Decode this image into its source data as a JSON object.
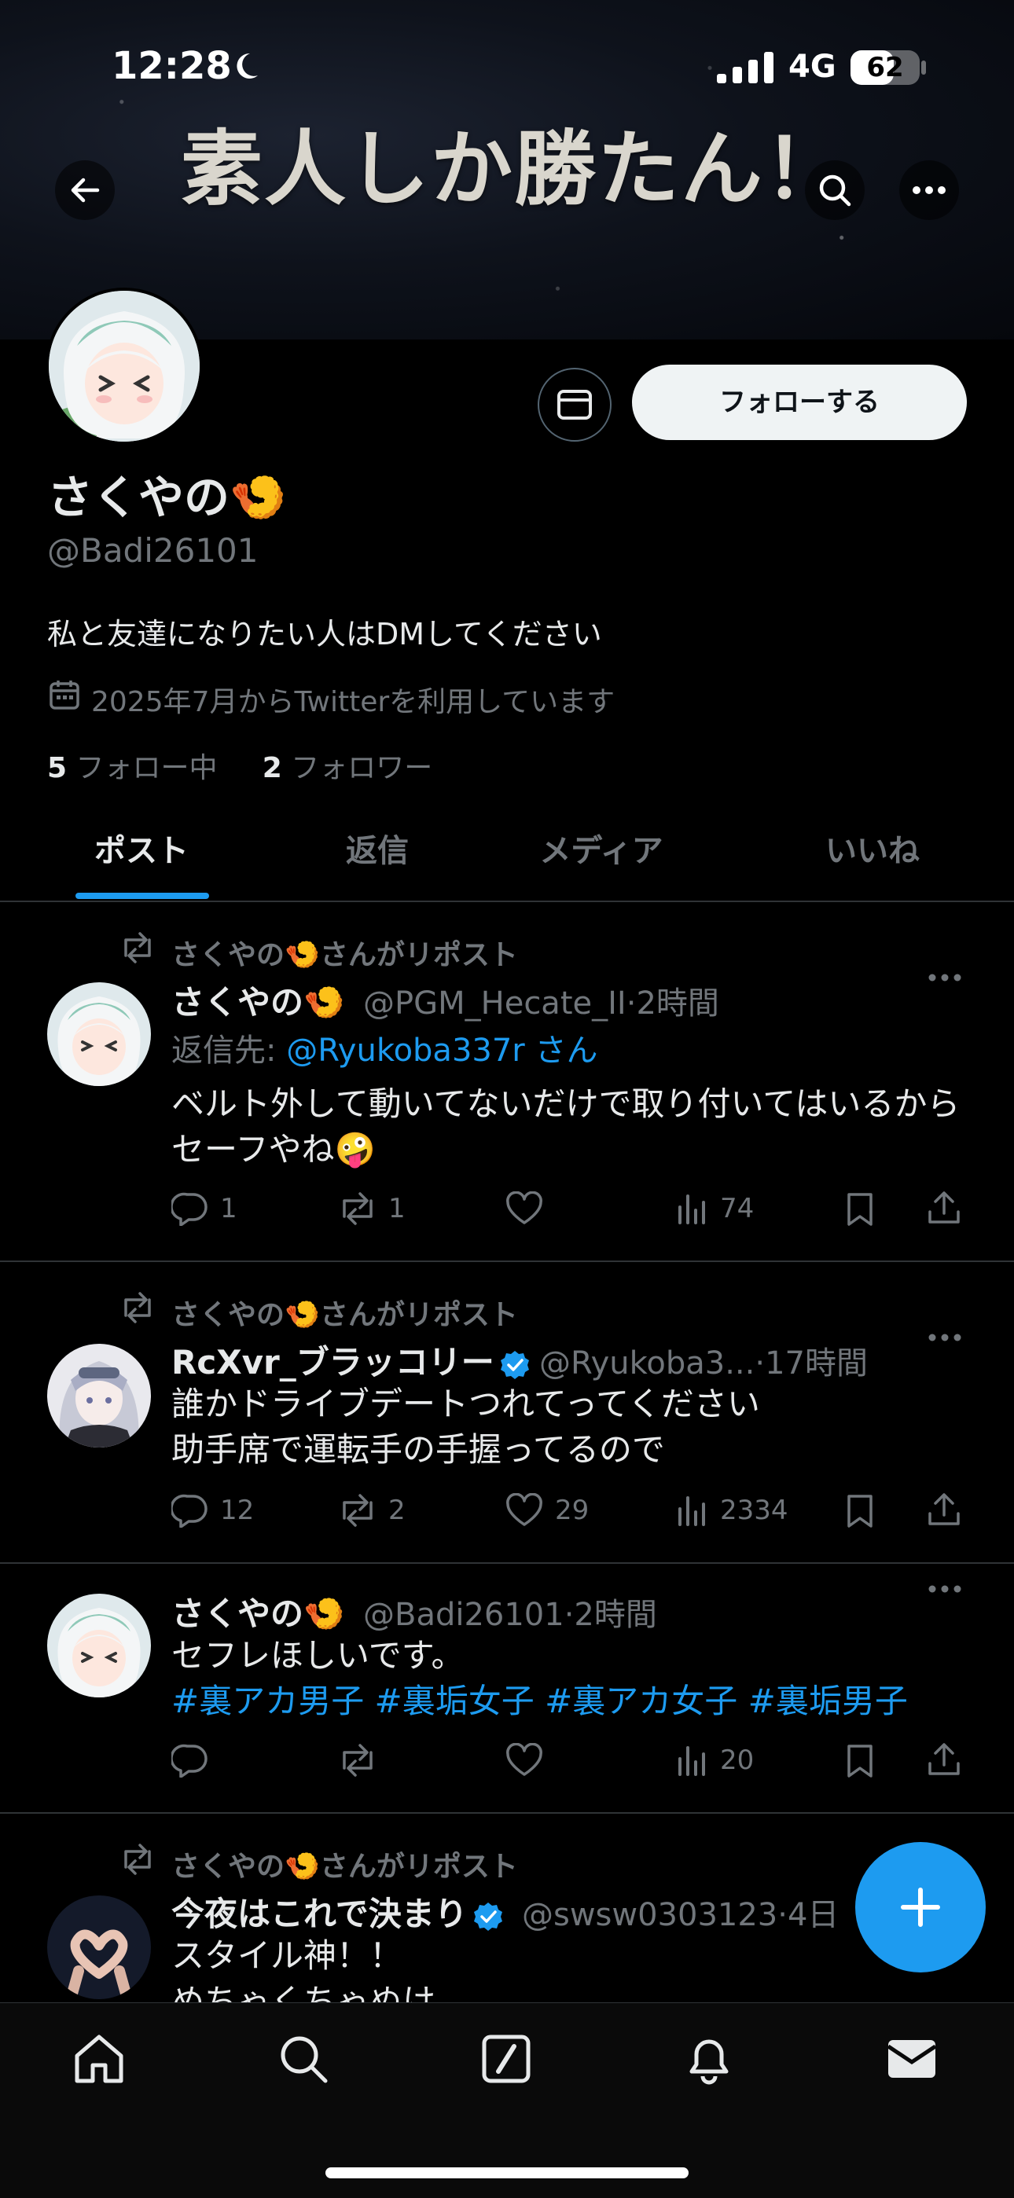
{
  "status_bar": {
    "time": "12:28",
    "network": "4G",
    "battery": "62",
    "battery_level": 0.62
  },
  "banner": {
    "title": "素人しか勝たん！"
  },
  "profile": {
    "display_name": "さくやの🍤",
    "handle": "@Badi26101",
    "bio": "私と友達になりたい人はDMしてください",
    "joined": "2025年7月からTwitterを利用しています",
    "following_count": "5",
    "following_label": "フォロー中",
    "followers_count": "2",
    "followers_label": "フォロワー",
    "follow_button": "フォローする"
  },
  "tabs": [
    "ポスト",
    "返信",
    "メディア",
    "いいね"
  ],
  "tweets": [
    {
      "repost_label": "さくやの🍤さんがリポスト",
      "name": "さくやの🍤",
      "handle": "@PGM_Hecate_II",
      "time": "2時間",
      "reply_prefix": "返信先: ",
      "reply_to": "@Ryukoba337r さん",
      "text_line1": "ベルト外して動いてないだけで取り付いてはいるから",
      "text_line2": "セーフやね🤪",
      "replies": "1",
      "reposts": "1",
      "likes": "",
      "views": "74"
    },
    {
      "repost_label": "さくやの🍤さんがリポスト",
      "name": "RcXvr_ブラッコリー",
      "handle": "@Ryukoba3...",
      "time": "17時間",
      "text_line1": "誰かドライブデートつれてってください",
      "text_line2": "助手席で運転手の手握ってるので",
      "replies": "12",
      "reposts": "2",
      "likes": "29",
      "views": "2334"
    },
    {
      "name": "さくやの🍤",
      "handle": "@Badi26101",
      "time": "2時間",
      "text_line1": "セフレほしいです。",
      "hashtags": "#裏アカ男子 #裏垢女子 #裏アカ女子 #裏垢男子",
      "replies": "",
      "reposts": "",
      "likes": "",
      "views": "20"
    },
    {
      "repost_label": "さくやの🍤さんがリポスト",
      "name": "今夜はこれで決まり",
      "handle": "@swsw0303123",
      "time": "4日",
      "text_line1": "スタイル神！！",
      "text_line2": "めちゃくちゃぬけ"
    }
  ],
  "colors": {
    "accent": "#1d9bf0",
    "background": "#000000",
    "text_primary": "#e7e9ea",
    "text_secondary": "#71767b"
  }
}
